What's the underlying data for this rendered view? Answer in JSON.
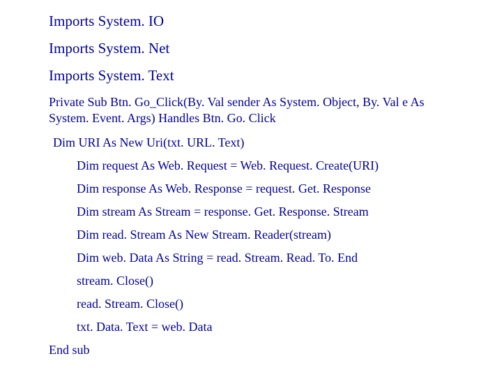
{
  "imports": [
    "Imports System. IO",
    "Imports System. Net",
    "Imports System. Text"
  ],
  "sub_declaration": "Private Sub Btn. Go_Click(By. Val sender As System. Object, By. Val e As System. Event. Args) Handles Btn. Go. Click",
  "dim_uri": "Dim URI As New Uri(txt. URL. Text)",
  "body": [
    "Dim request As Web. Request = Web. Request. Create(URI)",
    "Dim response As Web. Response = request. Get. Response",
    "Dim stream As Stream = response. Get. Response. Stream",
    "Dim read. Stream As New Stream. Reader(stream)",
    "Dim web. Data As String = read. Stream. Read. To. End",
    "stream. Close()",
    "read. Stream. Close()",
    "txt. Data. Text = web. Data"
  ],
  "end_sub": "End sub"
}
